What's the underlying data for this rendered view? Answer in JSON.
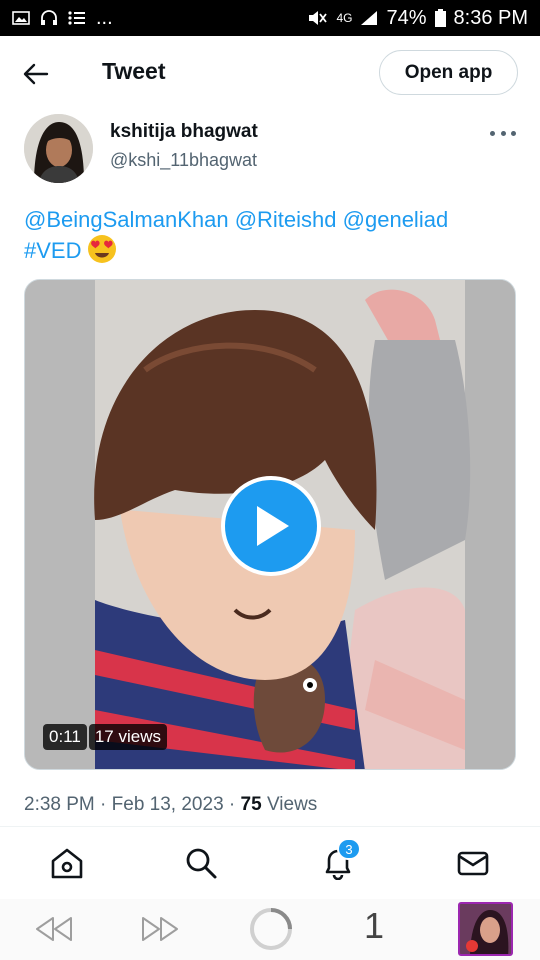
{
  "status_bar": {
    "left_dots": "...",
    "network": "4G",
    "battery": "74%",
    "time": "8:36 PM"
  },
  "header": {
    "title": "Tweet",
    "open_app_label": "Open app"
  },
  "author": {
    "name": "kshitija bhagwat",
    "handle": "@kshi_11bhagwat"
  },
  "tweet": {
    "mentions": [
      "@BeingSalmanKhan",
      "@Riteishd",
      "@geneliad"
    ],
    "hashtag": "#VED",
    "emoji": "heart-eyes-emoji"
  },
  "media": {
    "duration": "0:11",
    "views": "17 views"
  },
  "meta": {
    "time": "2:38 PM",
    "separator": "·",
    "date": "Feb 13, 2023",
    "views_count": "75",
    "views_label": "Views"
  },
  "tabbar": {
    "notifications_count": "3"
  },
  "browser": {
    "tab_count": "1"
  },
  "colors": {
    "accent": "#1d9bf0",
    "text": "#0f1419",
    "secondary_text": "#536471"
  }
}
